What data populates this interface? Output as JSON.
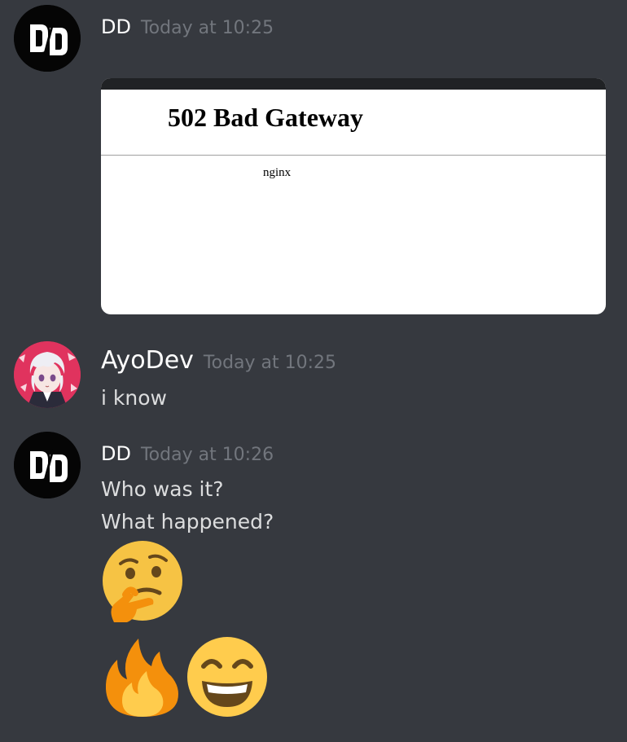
{
  "messages": [
    {
      "username": "DD",
      "timestamp": "Today at 10:25",
      "embed": {
        "title": "502 Bad Gateway",
        "server": "nginx"
      }
    },
    {
      "username": "AyoDev",
      "timestamp": "Today at 10:25",
      "lines": [
        "i know"
      ]
    },
    {
      "username": "DD",
      "timestamp": "Today at 10:26",
      "lines": [
        "Who was it?",
        "What happened?"
      ],
      "emojis": [
        "thinking-face",
        "fire",
        "grinning-face-with-smiling-eyes"
      ]
    }
  ],
  "colors": {
    "background": "#36393f",
    "username": "#ffffff",
    "timestamp": "#72767d",
    "message_text": "#dcddde"
  },
  "avatars": {
    "dd_logo_text": "DD"
  }
}
